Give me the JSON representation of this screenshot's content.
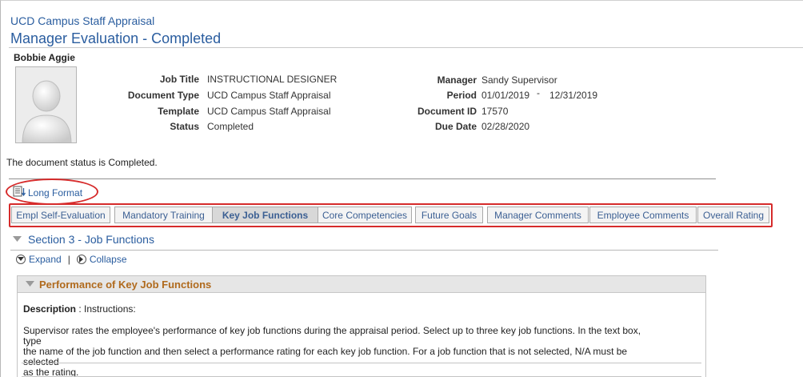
{
  "header": {
    "breadcrumb": "UCD Campus Staff Appraisal",
    "title": "Manager Evaluation - Completed",
    "employee_name": "Bobbie Aggie"
  },
  "avatar": {
    "icon": "person-silhouette-icon"
  },
  "details": {
    "left": [
      {
        "label": "Job Title",
        "value": "INSTRUCTIONAL DESIGNER"
      },
      {
        "label": "Document Type",
        "value": "UCD Campus Staff Appraisal"
      },
      {
        "label": "Template",
        "value": "UCD Campus Staff Appraisal"
      },
      {
        "label": "Status",
        "value": "Completed"
      }
    ],
    "right": [
      {
        "label": "Manager",
        "value": "Sandy Supervisor"
      },
      {
        "label": "Period",
        "value": "01/01/2019",
        "value_end": "12/31/2019",
        "separator": "-"
      },
      {
        "label": "Document ID",
        "value": "17570"
      },
      {
        "label": "Due Date",
        "value": "02/28/2020"
      }
    ]
  },
  "status_message": "The document status is Completed.",
  "long_format": {
    "label": "Long Format",
    "icon": "long-format-icon"
  },
  "tabs": [
    {
      "label": "Empl Self-Evaluation",
      "active": false
    },
    {
      "label": "Mandatory Training",
      "active": false
    },
    {
      "label": "Key Job Functions",
      "active": true
    },
    {
      "label": "Core Competencies",
      "active": false
    },
    {
      "label": "Future Goals",
      "active": false
    },
    {
      "label": "Manager Comments",
      "active": false
    },
    {
      "label": "Employee Comments",
      "active": false
    },
    {
      "label": "Overall Rating",
      "active": false
    }
  ],
  "section": {
    "title": "Section 3 - Job Functions",
    "expand_label": "Expand",
    "collapse_label": "Collapse",
    "separator": "|"
  },
  "panel": {
    "title": "Performance of Key Job Functions",
    "description_label": "Description",
    "description_value": ": Instructions:",
    "instructions": [
      "Supervisor rates the employee's performance of key job functions during the appraisal period. Select up to three key job functions. In the text box, type",
      "the name of the job function and then select a performance rating for each key job function. For a job function that is not selected, N/A must be selected",
      "as the rating."
    ]
  },
  "colors": {
    "link_blue": "#2a5d9f",
    "panel_title_orange": "#b06a1d",
    "highlight_red": "#d62b2b"
  }
}
